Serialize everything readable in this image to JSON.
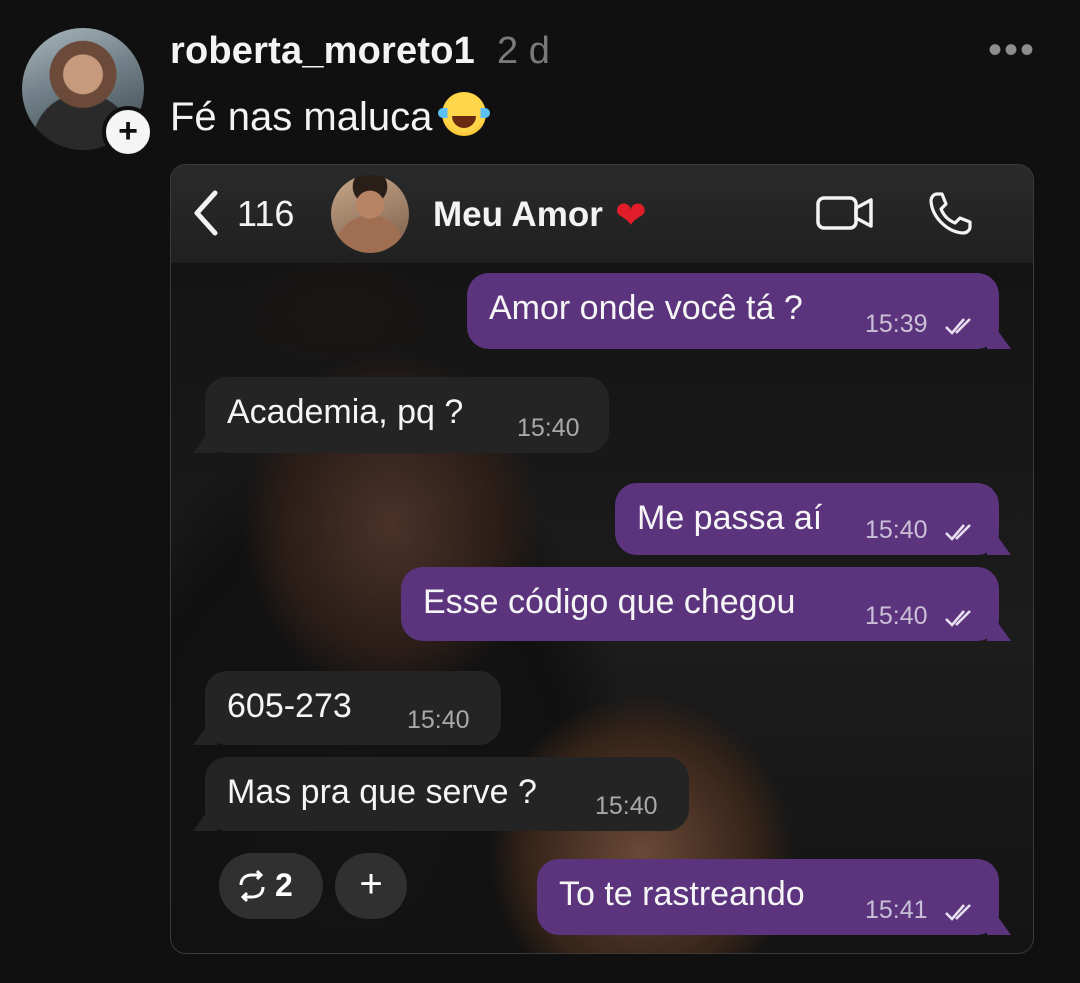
{
  "post": {
    "username": "roberta_moreto1",
    "time_ago": "2 d",
    "more_label": "•••",
    "caption": "Fé nas maluca",
    "caption_emoji": "face-with-tears-of-joy",
    "follow_label": "+"
  },
  "chat_header": {
    "back_count": "116",
    "contact_name": "Meu Amor",
    "contact_emoji": "❤"
  },
  "messages": [
    {
      "direction": "out",
      "text": "Amor onde você tá ?",
      "time": "15:39",
      "read": true
    },
    {
      "direction": "in",
      "text": "Academia, pq ?",
      "time": "15:40"
    },
    {
      "direction": "out",
      "text": "Me passa aí",
      "time": "15:40",
      "read": true
    },
    {
      "direction": "out",
      "text": "Esse código que chegou",
      "time": "15:40",
      "read": true
    },
    {
      "direction": "in",
      "text": "605-273",
      "time": "15:40"
    },
    {
      "direction": "in",
      "text": "Mas pra que serve ?",
      "time": "15:40"
    },
    {
      "direction": "out",
      "text": "To te rastreando",
      "time": "15:41",
      "read": true
    }
  ],
  "actions": {
    "repost_count": "2",
    "add_label": "+"
  },
  "colors": {
    "background": "#101010",
    "outgoing_bubble": "#5b347d",
    "incoming_bubble": "#242424",
    "heart": "#e11d2a"
  }
}
